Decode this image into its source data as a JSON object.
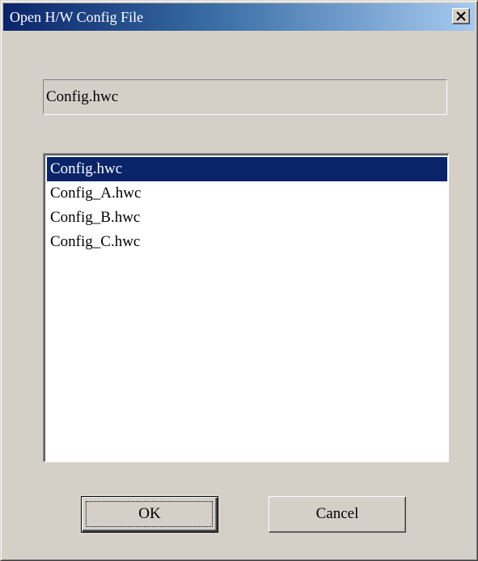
{
  "window": {
    "title": "Open H/W Config File",
    "close_icon": "close-x-icon"
  },
  "filename_field": {
    "value": "Config.hwc"
  },
  "file_list": {
    "selected_index": 0,
    "items": [
      {
        "label": "Config.hwc"
      },
      {
        "label": "Config_A.hwc"
      },
      {
        "label": "Config_B.hwc"
      },
      {
        "label": "Config_C.hwc"
      }
    ]
  },
  "buttons": {
    "ok_label": "OK",
    "cancel_label": "Cancel"
  },
  "colors": {
    "dialog_face": "#d4d0c8",
    "title_gradient_start": "#0a246a",
    "title_gradient_end": "#a6caf0",
    "selection": "#0a246a"
  }
}
